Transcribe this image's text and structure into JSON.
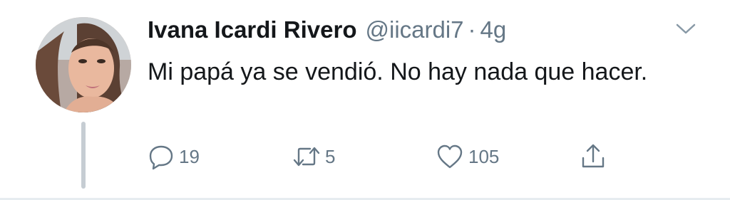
{
  "tweet": {
    "author_name": "Ivana Icardi Rivero",
    "handle": "@iicardi7",
    "separator": "·",
    "time": "4g",
    "text": "Mi papá ya se vendió. No hay nada que hacer."
  },
  "actions": {
    "replies": "19",
    "retweets": "5",
    "likes": "105"
  },
  "icons": {
    "reply": "reply-bubble-icon",
    "retweet": "retweet-icon",
    "like": "heart-icon",
    "share": "share-icon",
    "more": "chevron-down-icon"
  },
  "colors": {
    "text": "#14171a",
    "secondary": "#657786",
    "thread_line": "#c6cdd3",
    "divider": "#e6ecf0"
  }
}
